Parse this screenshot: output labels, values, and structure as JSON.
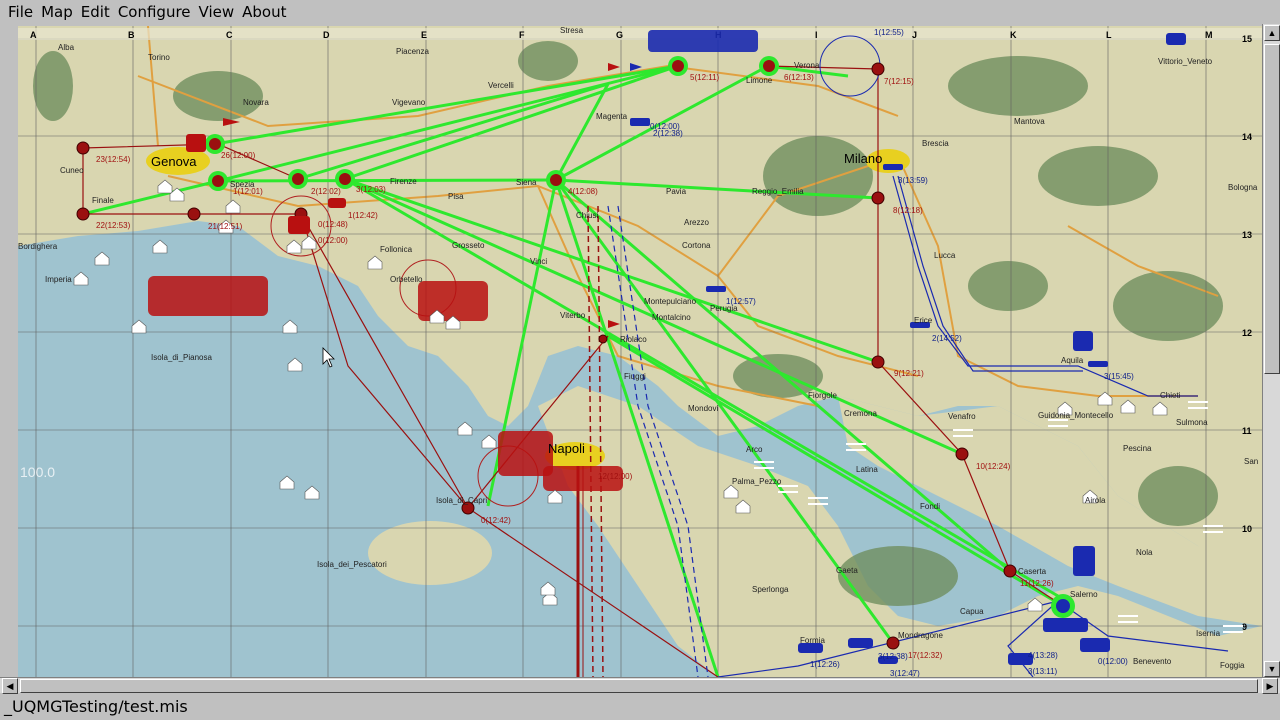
{
  "menu": [
    "File",
    "Map",
    "Edit",
    "Configure",
    "View",
    "About"
  ],
  "status": {
    "file_path": "_UQMGTesting/test.mis"
  },
  "map": {
    "scale_label": "100.0",
    "columns": [
      "A",
      "B",
      "C",
      "D",
      "E",
      "F",
      "G",
      "H",
      "I",
      "J",
      "K",
      "L",
      "M"
    ],
    "rows": [
      "15",
      "14",
      "13",
      "12",
      "11",
      "10",
      "9"
    ],
    "major_cities": [
      "Genova",
      "Milano",
      "Napoli"
    ],
    "cities": [
      "Alba",
      "Torino",
      "Piacenza",
      "Stresa",
      "Novara",
      "Vercelli",
      "Vigevano",
      "Magenta",
      "Limone",
      "Verona",
      "Vittorio_Veneto",
      "Mantova",
      "Brescia",
      "Bologna",
      "Cuneo",
      "Finale",
      "Spezia",
      "Firenze",
      "Siena",
      "Pisa",
      "Pavia",
      "Reggio_Emilia",
      "Arezzo",
      "Cortona",
      "Lucca",
      "Chiusi",
      "Bordighera",
      "Imperia",
      "Follonica",
      "Grosseto",
      "Orbetello",
      "Vinci",
      "Montepulciano",
      "Perugia",
      "Montalcino",
      "Viterbo",
      "Riolaco",
      "Erice",
      "Isola_di_Pianosa",
      "Fiuggi",
      "Mondovi",
      "Fiorgole",
      "Cremona",
      "Venafro",
      "Guidonia_Montecello",
      "Chieti",
      "Sulmona",
      "Aquila",
      "Arco",
      "Palma_Pezzo",
      "Latina",
      "Pescina",
      "San",
      "Isola_di_Capri",
      "Fondi",
      "Airola",
      "Nola",
      "Caserta",
      "Salerno",
      "Gaeta",
      "Sperlonga",
      "Capua",
      "Isernia",
      "Isola_dei_Pescatori",
      "Formia",
      "Mondragone",
      "Benevento",
      "Foggia"
    ],
    "red_waypoints": [
      "23(12:54)",
      "22(12:53)",
      "26(12:00)",
      "1(12:01)",
      "21(12:51)",
      "2(12:02)",
      "3(12:03)",
      "4(12:08)",
      "1(12:42)",
      "0(12:48)",
      "0(12:00)",
      "5(12:11)",
      "6(12:13)",
      "7(12:15)",
      "8(12:18)",
      "9(12:21)",
      "10(12:24)",
      "11(12:26)",
      "17(12:32)",
      "0(12:42)",
      "12(12:00)"
    ],
    "blue_waypoints": [
      "1(12:55)",
      "2(12:38)",
      "3(13:59)",
      "0(12:00)",
      "1(12:57)",
      "2(14:52)",
      "3(15:45)",
      "1(12:26)",
      "3(12:38)",
      "3(12:47)",
      "4(13:28)",
      "3(13:11)",
      "0(12:00)"
    ],
    "colors": {
      "land": "#d9d6b0",
      "sea": "#9fc3cf",
      "forest": "#6f8f5f",
      "road": "#e0a040",
      "route_green": "#2ee82e",
      "route_red": "#9a1010",
      "route_blue": "#1a2ab0",
      "grid": "#606060"
    }
  }
}
